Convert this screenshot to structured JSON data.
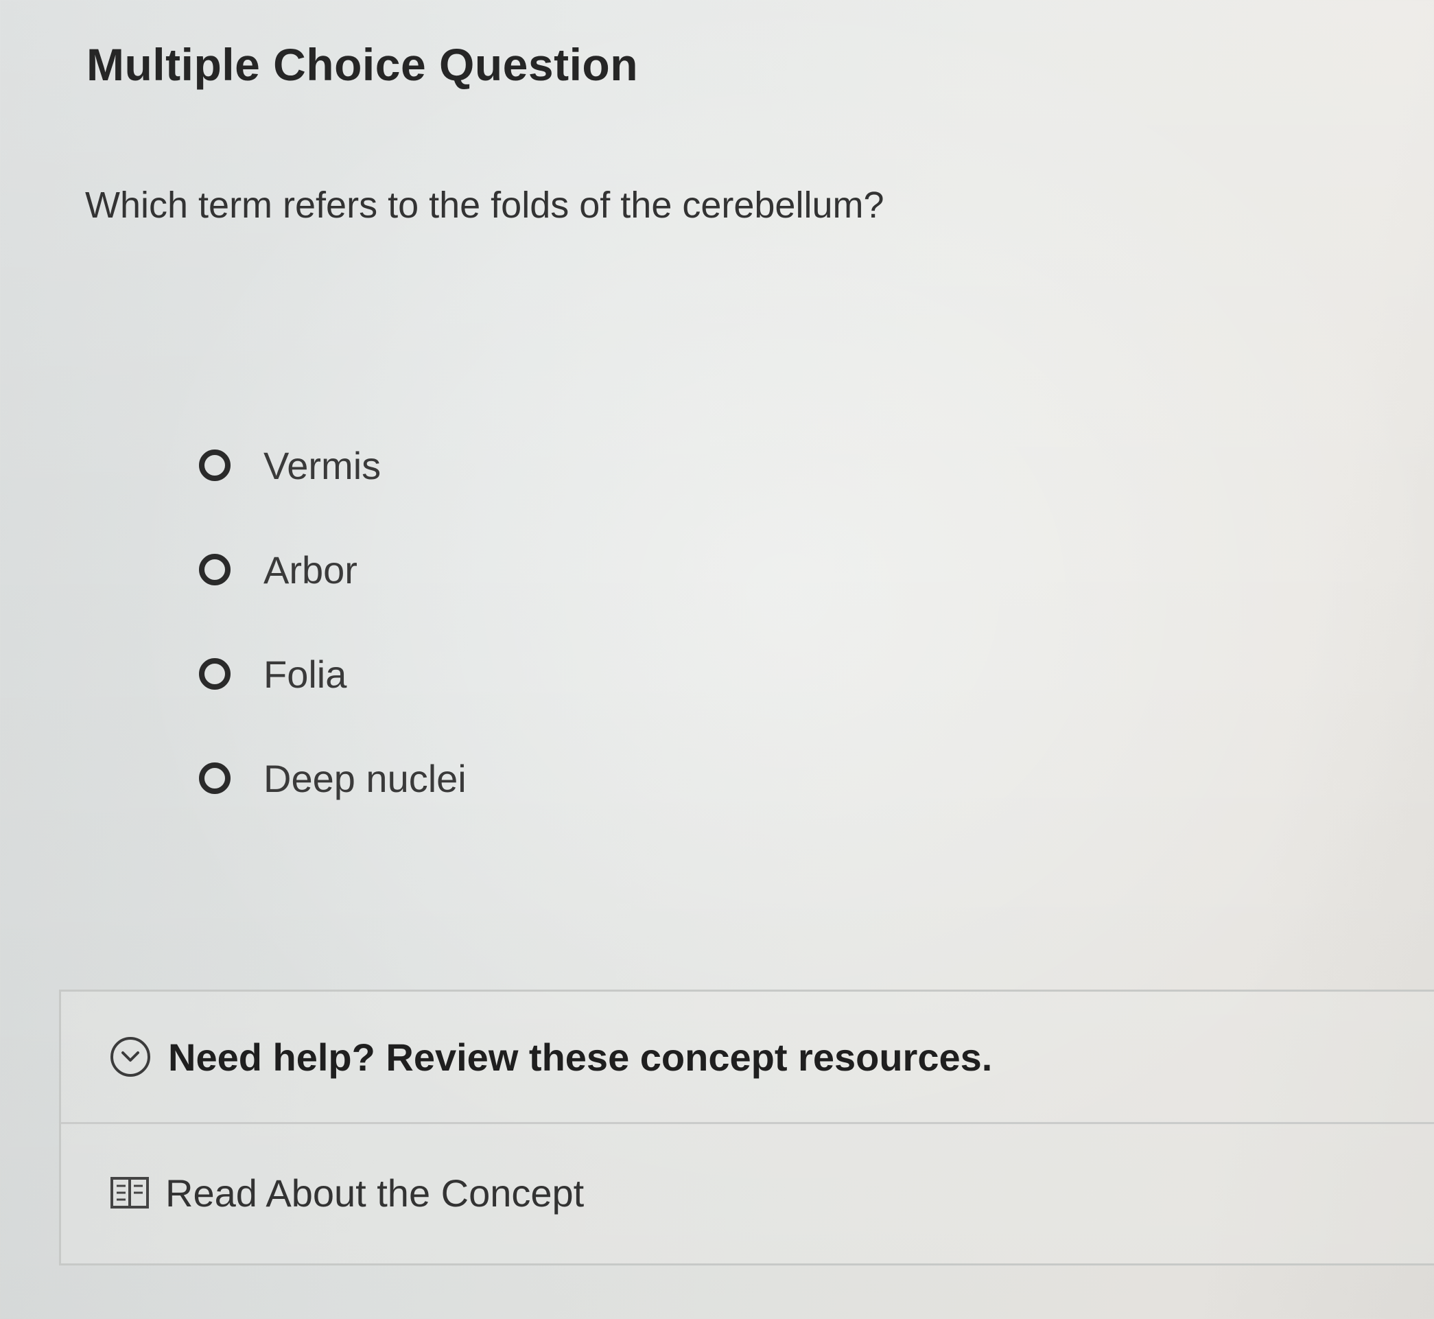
{
  "page": {
    "title": "Multiple Choice Question"
  },
  "question": {
    "text": "Which term refers to the folds of the cerebellum?",
    "choices": [
      {
        "label": "Vermis",
        "selected": false
      },
      {
        "label": "Arbor",
        "selected": false
      },
      {
        "label": "Folia",
        "selected": false
      },
      {
        "label": "Deep nuclei",
        "selected": false
      }
    ]
  },
  "help": {
    "title": "Need help? Review these concept resources.",
    "icon": "chevron-down-circle-icon",
    "resources": [
      {
        "label": "Read About the Concept",
        "icon": "book-icon"
      }
    ]
  },
  "colors": {
    "text_dark": "#262626",
    "text_body": "#333333",
    "border": "#c7c9c7"
  }
}
